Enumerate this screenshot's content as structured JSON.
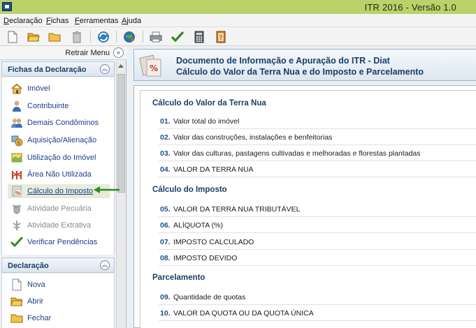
{
  "window": {
    "title": "ITR 2016 - Versão 1.0"
  },
  "menu": [
    "Declaração",
    "Fichas",
    "Ferramentas",
    "Ajuda"
  ],
  "toolbar": {
    "icons": [
      "new-document-icon",
      "open-folder-icon",
      "folder-icon",
      "trash-icon",
      "refresh-icon",
      "globe-icon",
      "print-icon",
      "check-icon",
      "calculator-icon",
      "help-book-icon"
    ],
    "colors": {
      "check": "#2e8b1f",
      "globe": "#2f6fb3"
    }
  },
  "sidebar": {
    "retrair_label": "Retrair Menu",
    "fichas": {
      "title": "Fichas da Declaração",
      "items": [
        {
          "label": "Imóvel",
          "icon": "house-icon"
        },
        {
          "label": "Contribuinte",
          "icon": "person-icon"
        },
        {
          "label": "Demais Condôminos",
          "icon": "people-icon"
        },
        {
          "label": "Aquisição/Alienação",
          "icon": "coin-icon"
        },
        {
          "label": "Utilização do Imóvel",
          "icon": "land-use-icon"
        },
        {
          "label": "Área Não Utilizada",
          "icon": "fence-icon"
        },
        {
          "label": "Cálculo do Imposto",
          "icon": "tax-percent-icon"
        },
        {
          "label": "Atividade Pecuária",
          "icon": "cattle-icon"
        },
        {
          "label": "Atividade Extrativa",
          "icon": "tree-icon"
        },
        {
          "label": "Verificar Pendências",
          "icon": "check-icon"
        }
      ]
    },
    "declaracao": {
      "title": "Declaração",
      "items": [
        {
          "label": "Nova",
          "icon": "new-document-icon"
        },
        {
          "label": "Abrir",
          "icon": "open-folder-icon"
        },
        {
          "label": "Fechar",
          "icon": "folder-icon"
        }
      ]
    }
  },
  "header": {
    "line1": "Documento de Informação e Apuração do ITR - Diat",
    "line2": "Cálculo do Valor da Terra Nua e do Imposto e Parcelamento"
  },
  "groups": [
    {
      "title": "Cálculo do Valor da Terra Nua",
      "rows": [
        {
          "num": "01.",
          "label": "Valor total do imóvel"
        },
        {
          "num": "02.",
          "label": "Valor das construções, instalações e benfeitorias"
        },
        {
          "num": "03.",
          "label": "Valor das culturas, pastagens cultivadas e melhoradas e florestas plantadas"
        },
        {
          "num": "04.",
          "label": "VALOR DA TERRA NUA"
        }
      ]
    },
    {
      "title": "Cálculo do Imposto",
      "rows": [
        {
          "num": "05.",
          "label": "VALOR DA TERRA NUA TRIBUTÁVEL"
        },
        {
          "num": "06.",
          "label": "ALÍQUOTA (%)"
        },
        {
          "num": "07.",
          "label": "IMPOSTO CALCULADO"
        },
        {
          "num": "08.",
          "label": "IMPOSTO DEVIDO"
        }
      ]
    },
    {
      "title": "Parcelamento",
      "rows": [
        {
          "num": "09.",
          "label": "Quantidade de quotas"
        },
        {
          "num": "10.",
          "label": "VALOR DA QUOTA OU DA QUOTA ÚNICA"
        }
      ]
    }
  ],
  "colors": {
    "titlebar": "#b9d26a",
    "heading": "#1c3f66",
    "arrow": "#2a8a22"
  }
}
